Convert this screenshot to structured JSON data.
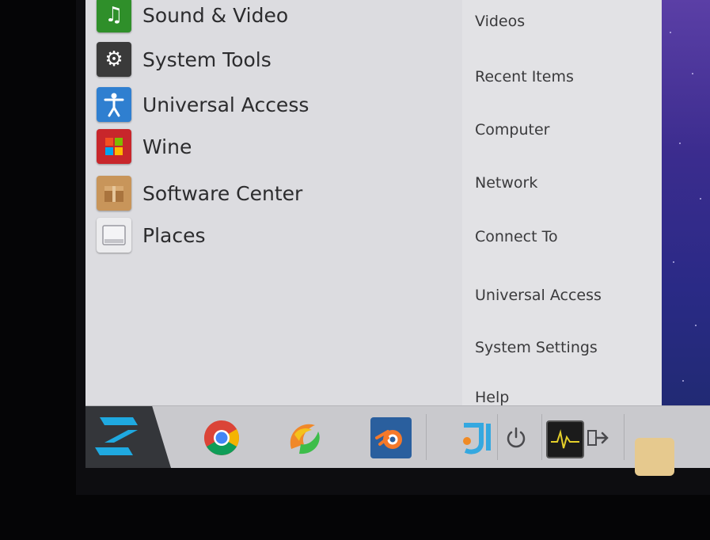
{
  "menu": {
    "categories": [
      {
        "label": "Sound & Video",
        "icon": "music-note-icon",
        "color": "#2f8f2a"
      },
      {
        "label": "System Tools",
        "icon": "system-tools-icon",
        "color": "#3a3a3a"
      },
      {
        "label": "Universal Access",
        "icon": "accessibility-icon",
        "color": "#2f7fd0"
      },
      {
        "label": "Wine",
        "icon": "wine-icon",
        "color": "#c8262b"
      },
      {
        "label": "Software Center",
        "icon": "package-icon",
        "color": "#c8955a"
      },
      {
        "label": "Places",
        "icon": "drive-icon",
        "color": "#e8e8ea"
      }
    ],
    "places": [
      "Videos",
      "Recent Items",
      "Computer",
      "Network",
      "Connect To",
      "Universal Access",
      "System Settings",
      "Help"
    ]
  },
  "taskbar": {
    "launchers": [
      {
        "icon": "chrome-icon"
      },
      {
        "icon": "pycharm-icon"
      },
      {
        "icon": "blender-icon"
      },
      {
        "icon": "app-icon"
      }
    ],
    "tray": [
      {
        "icon": "power-icon"
      },
      {
        "icon": "system-monitor-icon"
      },
      {
        "icon": "logout-icon"
      },
      {
        "icon": "folder-icon"
      }
    ]
  },
  "colors": {
    "menu_bg": "#dcdce0",
    "taskbar_bg": "#c9c9cd",
    "zorin_blue": "#1fa9e0"
  }
}
